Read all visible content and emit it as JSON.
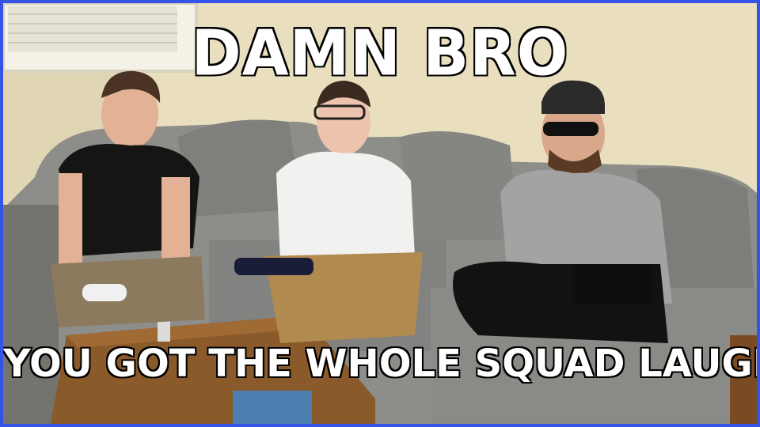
{
  "meme": {
    "top_text": "DAMN BRO",
    "bottom_text": "YOU GOT THE WHOLE SQUAD LAUGHING"
  },
  "colors": {
    "border": "#3653e8",
    "wall": "#e9dfbf",
    "couch": "#8a8a86",
    "table": "#8b5a2b",
    "caption_fill": "#ffffff",
    "caption_stroke": "#000000"
  }
}
